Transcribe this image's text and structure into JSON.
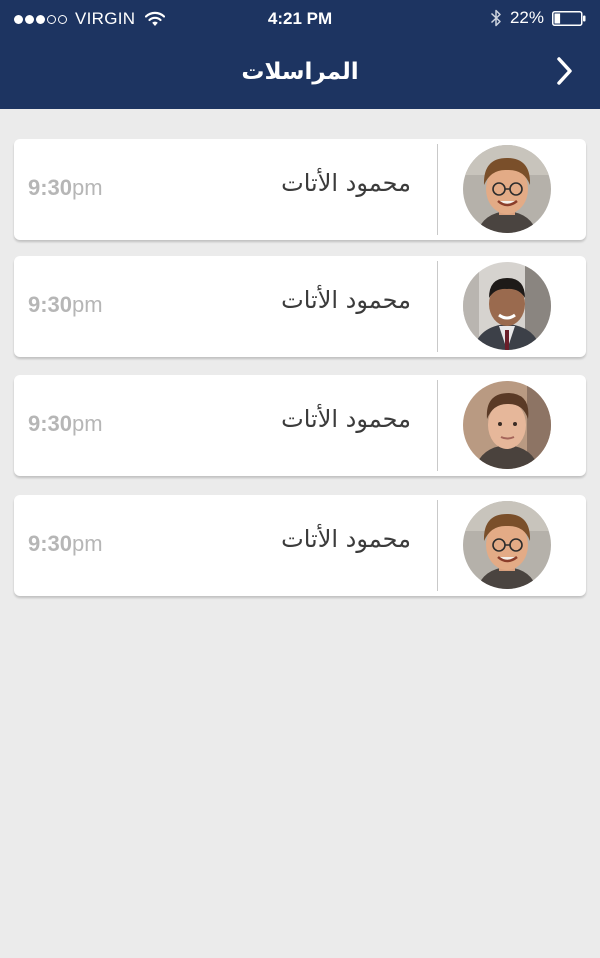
{
  "status_bar": {
    "carrier": "VIRGIN",
    "time": "4:21 PM",
    "battery": "22%",
    "signal_bars_filled": 3,
    "signal_bars_total": 5,
    "battery_level": 0.22
  },
  "header": {
    "title": "المراسلات",
    "back_icon": "chevron-right-icon",
    "background": "#1d3461"
  },
  "conversations": [
    {
      "name": "محمود الأتات",
      "time_hour": "9:30",
      "time_suffix": "pm",
      "avatar": "avatar-man-glasses"
    },
    {
      "name": "محمود الأتات",
      "time_hour": "9:30",
      "time_suffix": "pm",
      "avatar": "avatar-man-suit"
    },
    {
      "name": "محمود الأتات",
      "time_hour": "9:30",
      "time_suffix": "pm",
      "avatar": "avatar-man-young"
    },
    {
      "name": "محمود الأتات",
      "time_hour": "9:30",
      "time_suffix": "pm",
      "avatar": "avatar-man-glasses"
    }
  ]
}
